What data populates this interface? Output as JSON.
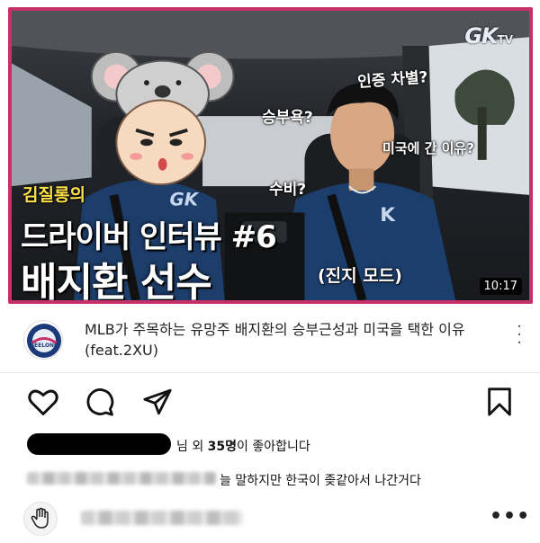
{
  "video": {
    "brand": "GK",
    "brand_suffix": "TV",
    "questions": [
      "인증 차별?",
      "승부욕?",
      "미국에 간 이유?",
      "수비?"
    ],
    "title_small": "김질롱의",
    "title_medium": "드라이버 인터뷰 #6",
    "title_large": "배지환 선수",
    "mode_caption": "(진지 모드)",
    "duration": "10:17",
    "jersey_logo": "GK",
    "accent_color": "#c8306a"
  },
  "video_info": {
    "channel_avatar_label": "GEELONG",
    "title": "MLB가 주목하는 유망주 배지환의 승부근성과 미국을 택한 이유(feat.2XU)",
    "more_icon": "vertical-dots-icon"
  },
  "actions": {
    "like_icon": "heart-icon",
    "comment_icon": "comment-icon",
    "share_icon": "send-icon",
    "save_icon": "bookmark-icon"
  },
  "likes": {
    "prefix": "님 외 ",
    "count": "35명",
    "suffix": "이 좋아합니다"
  },
  "comment": {
    "text": "늘 말하지만 한국이 좆같아서 나간거다"
  },
  "reply": {
    "avatar_icon": "hand-icon",
    "more": "•••"
  }
}
